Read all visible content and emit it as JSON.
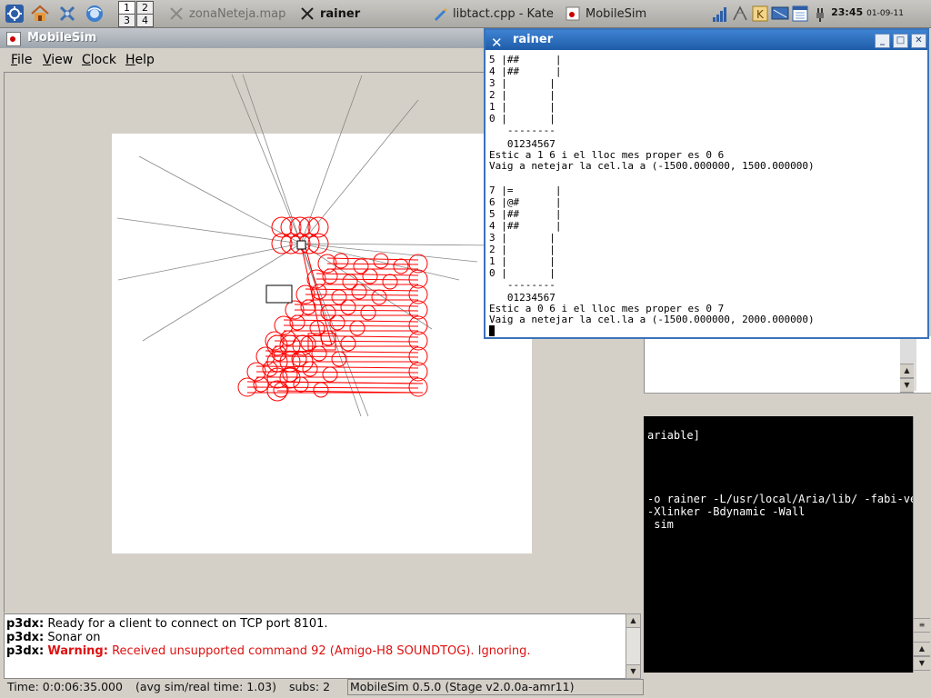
{
  "panel": {
    "desktops": [
      "1",
      "2",
      "3",
      "4"
    ],
    "tasks": [
      {
        "label": "zonaNeteja.map",
        "icon": "x-icon",
        "state": "dim"
      },
      {
        "label": "rainer",
        "icon": "x-icon",
        "state": "bold"
      },
      {
        "label": "libtact.cpp - Kate",
        "icon": "kate-icon",
        "state": "normal"
      },
      {
        "label": "MobileSim",
        "icon": "mobilesim-icon",
        "state": "normal"
      }
    ],
    "clock": {
      "time": "23:45",
      "date": "01-09-11"
    }
  },
  "mobilesim": {
    "title": "MobileSim",
    "menu": [
      "File",
      "View",
      "Clock",
      "Help"
    ],
    "log": [
      {
        "source": "p3dx:",
        "warning": "",
        "text": "Ready for a client to connect on TCP port 8101."
      },
      {
        "source": "p3dx:",
        "warning": "",
        "text": "Sonar on"
      },
      {
        "source": "p3dx:",
        "warning": "Warning:",
        "text": "Received unsupported command 92 (Amigo-H8 SOUNDTOG). Ignoring."
      }
    ],
    "status": {
      "time": "Time: 0:0:06:35.000",
      "avg": "(avg sim/real time: 1.03)",
      "subs": "subs: 2",
      "version": "MobileSim 0.5.0 (Stage v2.0.0a-amr11)"
    },
    "colors": {
      "trail": "#ff0000",
      "rays": "#888888",
      "map_bg": "#ffffff"
    }
  },
  "konsole": {
    "lines": [
      "ariable]",
      "",
      "",
      "",
      "-o rainer -L/usr/local/Aria/lib/ -fabi-ve",
      "-Xlinker -Bdynamic -Wall",
      " sim"
    ]
  },
  "terminal": {
    "title": "rainer",
    "lines": [
      "5 |##      |",
      "4 |##      |",
      "3 |       |",
      "2 |       |",
      "1 |       |",
      "0 |       |",
      "   --------",
      "   01234567",
      "Estic a 1 6 i el lloc mes proper es 0 6",
      "Vaig a netejar la cel.la a (-1500.000000, 1500.000000)",
      "",
      "7 |=       |",
      "6 |@#      |",
      "5 |##      |",
      "4 |##      |",
      "3 |       |",
      "2 |       |",
      "1 |       |",
      "0 |       |",
      "   --------",
      "   01234567",
      "Estic a 0 6 i el lloc mes proper es 0 7",
      "Vaig a netejar la cel.la a (-1500.000000, 2000.000000)"
    ]
  }
}
